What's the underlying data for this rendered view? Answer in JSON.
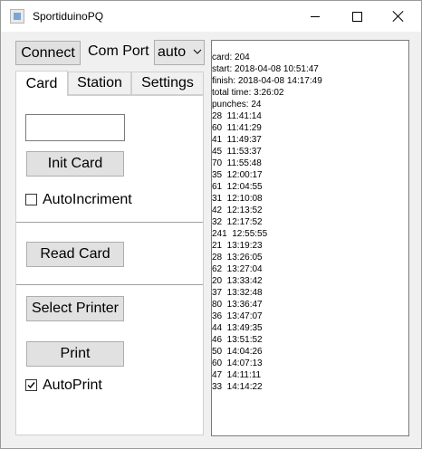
{
  "window": {
    "title": "SportiduinoPQ"
  },
  "toolbar": {
    "connect_label": "Connect",
    "comport_label": "Com Port",
    "comport_value": "auto"
  },
  "tabs": [
    {
      "label": "Card",
      "active": true
    },
    {
      "label": "Station",
      "active": false
    },
    {
      "label": "Settings",
      "active": false
    }
  ],
  "card_tab": {
    "card_number_value": "",
    "init_card_label": "Init Card",
    "auto_increment_label": "AutoIncriment",
    "auto_increment_checked": false,
    "read_card_label": "Read Card",
    "select_printer_label": "Select Printer",
    "print_label": "Print",
    "auto_print_label": "AutoPrint",
    "auto_print_checked": true
  },
  "log": {
    "lines": [
      "card: 204",
      "start: 2018-04-08 10:51:47",
      "finish: 2018-04-08 14:17:49",
      "total time: 3:26:02",
      "punches: 24",
      "28  11:41:14",
      "60  11:41:29",
      "41  11:49:37",
      "45  11:53:37",
      "70  11:55:48",
      "35  12:00:17",
      "61  12:04:55",
      "31  12:10:08",
      "42  12:13:52",
      "32  12:17:52",
      "241  12:55:55",
      "21  13:19:23",
      "28  13:26:05",
      "62  13:27:04",
      "20  13:33:42",
      "37  13:32:48",
      "80  13:36:47",
      "36  13:47:07",
      "44  13:49:35",
      "46  13:51:52",
      "50  14:04:26",
      "60  14:07:13",
      "47  14:11:11",
      "33  14:14:22"
    ]
  }
}
